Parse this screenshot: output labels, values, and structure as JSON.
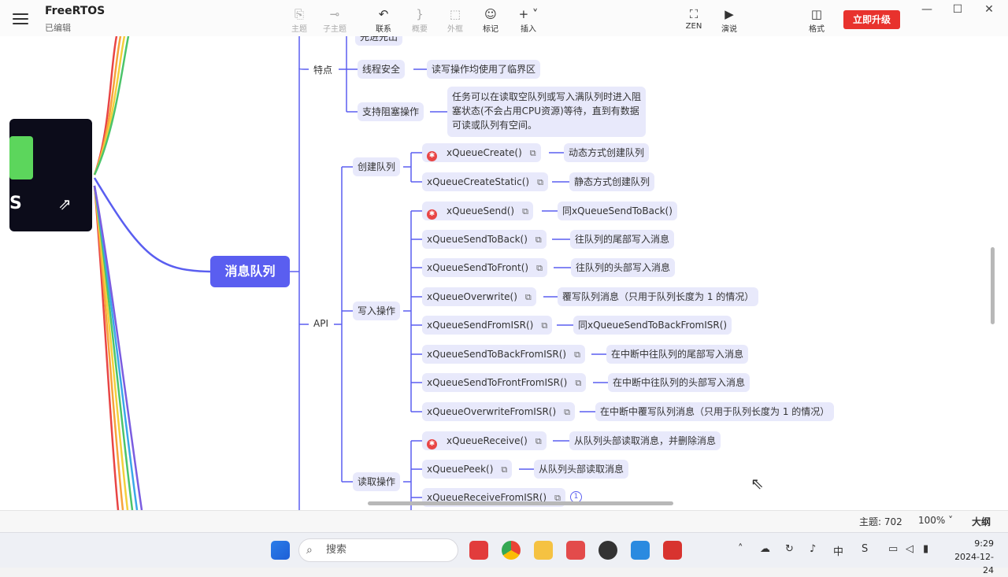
{
  "app": {
    "title": "FreeRTOS",
    "status": "已编辑"
  },
  "toolbar": {
    "topic": "主题",
    "subtopic": "子主题",
    "relation": "联系",
    "summary": "概要",
    "boundary": "外框",
    "marker": "标记",
    "insert": "插入",
    "zen": "ZEN",
    "present": "演说",
    "format": "格式",
    "upgrade": "立即升级"
  },
  "mindmap": {
    "central": "消息队列",
    "features": {
      "label": "特点",
      "fifo": "先进先出",
      "thread_safe": "线程安全",
      "thread_safe_note": "读写操作均使用了临界区",
      "blocking": "支持阻塞操作",
      "blocking_note_1": "任务可以在读取空队列或写入满队列时进入阻",
      "blocking_note_2": "塞状态(不会占用CPU资源)等待，直到有数据",
      "blocking_note_3": "可读或队列有空间。"
    },
    "api": {
      "label": "API",
      "create": {
        "label": "创建队列",
        "items": [
          {
            "fn": "xQueueCreate()",
            "note": "动态方式创建队列"
          },
          {
            "fn": "xQueueCreateStatic()",
            "note": "静态方式创建队列"
          }
        ]
      },
      "write": {
        "label": "写入操作",
        "items": [
          {
            "fn": "xQueueSend()",
            "note": "同xQueueSendToBack()"
          },
          {
            "fn": "xQueueSendToBack()",
            "note": "往队列的尾部写入消息"
          },
          {
            "fn": "xQueueSendToFront()",
            "note": "往队列的头部写入消息"
          },
          {
            "fn": "xQueueOverwrite()",
            "note": "覆写队列消息（只用于队列长度为 1 的情况）"
          },
          {
            "fn": "xQueueSendFromISR()",
            "note": "同xQueueSendToBackFromISR()"
          },
          {
            "fn": "xQueueSendToBackFromISR()",
            "note": "在中断中往队列的尾部写入消息"
          },
          {
            "fn": "xQueueSendToFrontFromISR()",
            "note": "在中断中往队列的头部写入消息"
          },
          {
            "fn": "xQueueOverwriteFromISR()",
            "note": "在中断中覆写队列消息（只用于队列长度为 1 的情况）"
          }
        ]
      },
      "read": {
        "label": "读取操作",
        "items": [
          {
            "fn": "xQueueReceive()",
            "note": "从队列头部读取消息，并删除消息"
          },
          {
            "fn": "xQueuePeek()",
            "note": "从队列头部读取消息"
          },
          {
            "fn": "xQueueReceiveFromISR()",
            "note": ""
          }
        ],
        "badge": "1"
      }
    }
  },
  "statusbar": {
    "topics": "主题: 702",
    "zoom": "100%",
    "outline": "大纲"
  },
  "taskbar": {
    "search": "搜索",
    "time": "9:29",
    "date": "2024-12-24"
  },
  "colors": {
    "accent": "#5a5ef0",
    "node_bg": "#e8e9fb",
    "upgrade": "#e8322d"
  }
}
